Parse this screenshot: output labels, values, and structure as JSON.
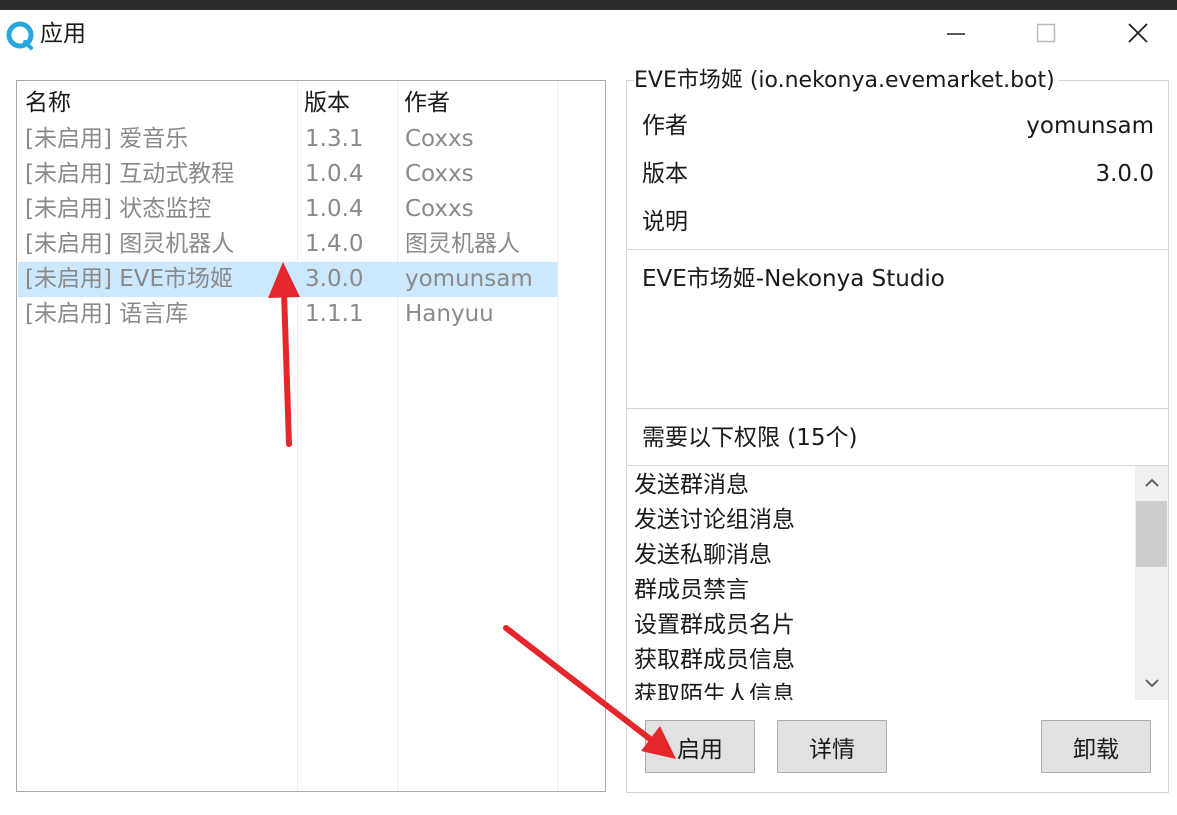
{
  "window": {
    "title": "应用",
    "controls": [
      "minimize",
      "maximize",
      "close"
    ]
  },
  "app_list": {
    "columns": [
      "名称",
      "版本",
      "作者"
    ],
    "rows": [
      {
        "name": "[未启用] 爱音乐",
        "version": "1.3.1",
        "author": "Coxxs",
        "selected": false
      },
      {
        "name": "[未启用] 互动式教程",
        "version": "1.0.4",
        "author": "Coxxs",
        "selected": false
      },
      {
        "name": "[未启用] 状态监控",
        "version": "1.0.4",
        "author": "Coxxs",
        "selected": false
      },
      {
        "name": "[未启用] 图灵机器人",
        "version": "1.4.0",
        "author": "图灵机器人",
        "selected": false
      },
      {
        "name": "[未启用] EVE市场姬",
        "version": "3.0.0",
        "author": "yomunsam",
        "selected": true
      },
      {
        "name": "[未启用] 语言库",
        "version": "1.1.1",
        "author": "Hanyuu",
        "selected": false
      }
    ]
  },
  "detail": {
    "group_title": "EVE市场姬 (io.nekonya.evemarket.bot)",
    "author_label": "作者",
    "author_value": "yomunsam",
    "version_label": "版本",
    "version_value": "3.0.0",
    "description_label": "说明",
    "description": "EVE市场姬-Nekonya Studio",
    "permissions_title": "需要以下权限 (15个)",
    "permissions": [
      "发送群消息",
      "发送讨论组消息",
      "发送私聊消息",
      "群成员禁言",
      "设置群成员名片",
      "获取群成员信息",
      "获取陌生人信息"
    ]
  },
  "buttons": {
    "enable": "启用",
    "details": "详情",
    "uninstall": "卸载"
  },
  "colors": {
    "selection": "#cce8ff",
    "disabled_text": "#8a8a8a",
    "annotation_arrow": "#e5262a",
    "app_icon": "#2aa6df"
  }
}
